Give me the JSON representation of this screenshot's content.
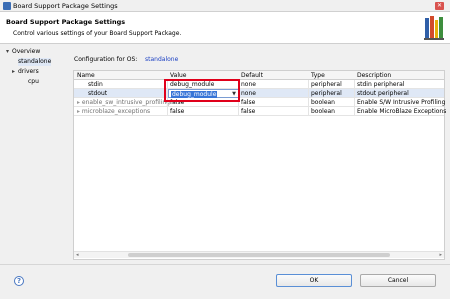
{
  "window": {
    "title": "Board Support Package Settings"
  },
  "header": {
    "title": "Board Support Package Settings",
    "subtitle": "Control various settings of your Board Support Package."
  },
  "tree": [
    {
      "label": "Overview",
      "expanded": true
    },
    {
      "label": "standalone",
      "selected": true
    },
    {
      "label": "drivers",
      "expanded": false
    },
    {
      "label": "cpu"
    }
  ],
  "config": {
    "label": "Configuration for OS:",
    "value": "standalone"
  },
  "table": {
    "columns": [
      "Name",
      "Value",
      "Default",
      "Type",
      "Description"
    ],
    "rows": [
      {
        "name": "stdin",
        "value": "debug_module",
        "default": "none",
        "type": "peripheral",
        "description": "stdin peripheral"
      },
      {
        "name": "stdout",
        "value": "debug_module",
        "default": "none",
        "type": "peripheral",
        "description": "stdout peripheral"
      },
      {
        "name": "enable_sw_intrusive_profiling",
        "value": "false",
        "default": "false",
        "type": "boolean",
        "description": "Enable S/W Intrusive Profiling"
      },
      {
        "name": "microblaze_exceptions",
        "value": "false",
        "default": "false",
        "type": "boolean",
        "description": "Enable MicroBlaze Exceptions"
      }
    ]
  },
  "buttons": {
    "help": "?",
    "ok": "OK",
    "cancel": "Cancel"
  }
}
